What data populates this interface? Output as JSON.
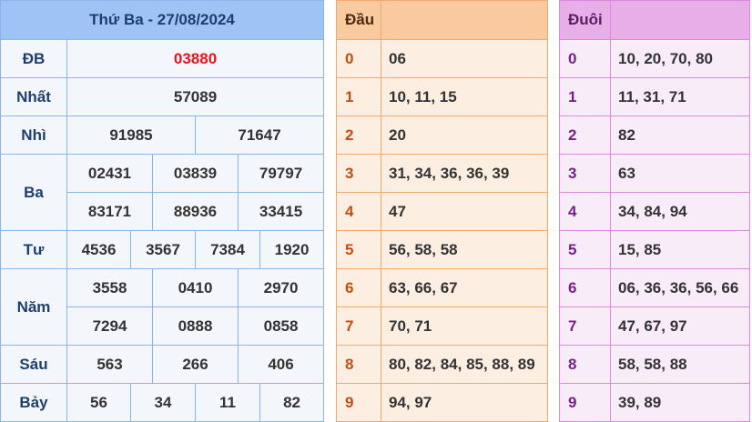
{
  "results": {
    "title": "Thứ Ba - 27/08/2024",
    "rows": [
      {
        "label": "ĐB",
        "values": [
          "03880"
        ]
      },
      {
        "label": "Nhất",
        "values": [
          "57089"
        ]
      },
      {
        "label": "Nhì",
        "values": [
          "91985",
          "71647"
        ]
      },
      {
        "label": "Ba",
        "values": [
          "02431",
          "03839",
          "79797",
          "83171",
          "88936",
          "33415"
        ]
      },
      {
        "label": "Tư",
        "values": [
          "4536",
          "3567",
          "7384",
          "1920"
        ]
      },
      {
        "label": "Năm",
        "values": [
          "3558",
          "0410",
          "2970",
          "7294",
          "0888",
          "0858"
        ]
      },
      {
        "label": "Sáu",
        "values": [
          "563",
          "266",
          "406"
        ]
      },
      {
        "label": "Bảy",
        "values": [
          "56",
          "34",
          "11",
          "82"
        ]
      }
    ]
  },
  "dau": {
    "header": "Đầu",
    "rows": [
      {
        "key": "0",
        "value": "06"
      },
      {
        "key": "1",
        "value": "10, 11, 15"
      },
      {
        "key": "2",
        "value": "20"
      },
      {
        "key": "3",
        "value": "31, 34, 36, 36, 39"
      },
      {
        "key": "4",
        "value": "47"
      },
      {
        "key": "5",
        "value": "56, 58, 58"
      },
      {
        "key": "6",
        "value": "63, 66, 67"
      },
      {
        "key": "7",
        "value": "70, 71"
      },
      {
        "key": "8",
        "value": "80, 82, 84, 85, 88, 89"
      },
      {
        "key": "9",
        "value": "94, 97"
      }
    ]
  },
  "duoi": {
    "header": "Đuôi",
    "rows": [
      {
        "key": "0",
        "value": "10, 20, 70, 80"
      },
      {
        "key": "1",
        "value": "11, 31, 71"
      },
      {
        "key": "2",
        "value": "82"
      },
      {
        "key": "3",
        "value": "63"
      },
      {
        "key": "4",
        "value": "34, 84, 94"
      },
      {
        "key": "5",
        "value": "15, 85"
      },
      {
        "key": "6",
        "value": "06, 36, 36, 56, 66"
      },
      {
        "key": "7",
        "value": "47, 67, 97"
      },
      {
        "key": "8",
        "value": "58, 58, 88"
      },
      {
        "key": "9",
        "value": "39, 89"
      }
    ]
  },
  "colors": {
    "results_header": "#9ec3f4",
    "special_prize": "#e4141b",
    "dau_header": "#f9c9a0",
    "duoi_header": "#e7aee8"
  }
}
